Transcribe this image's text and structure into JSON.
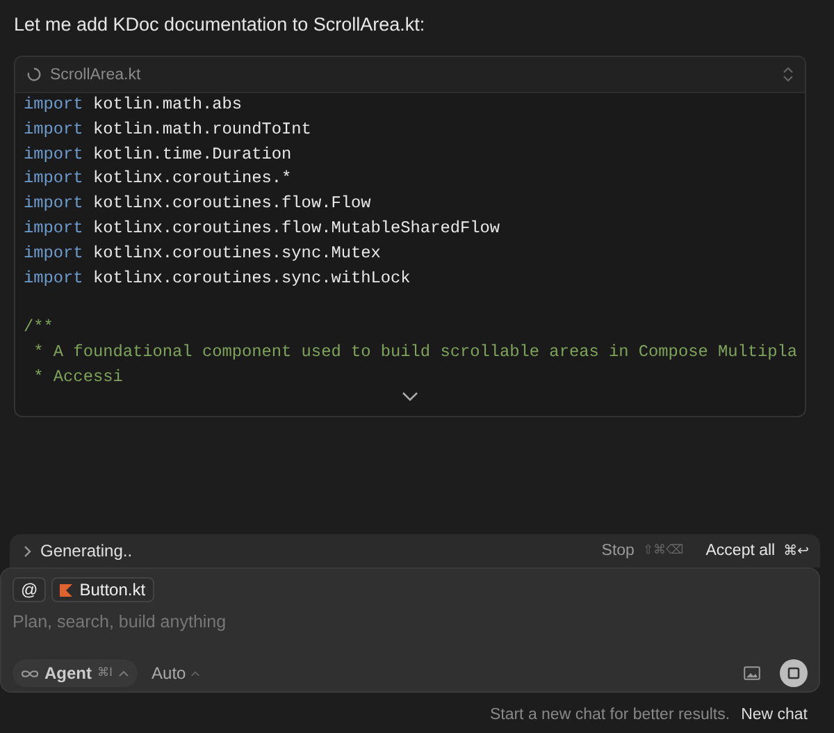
{
  "message": "Let me add KDoc documentation to ScrollArea.kt:",
  "code_card": {
    "file_name": "ScrollArea.kt",
    "lines": [
      {
        "kind": "import",
        "keyword": "import",
        "text": "kotlin.math.abs"
      },
      {
        "kind": "import",
        "keyword": "import",
        "text": "kotlin.math.roundToInt"
      },
      {
        "kind": "import",
        "keyword": "import",
        "text": "kotlin.time.Duration"
      },
      {
        "kind": "import",
        "keyword": "import",
        "text": "kotlinx.coroutines.*"
      },
      {
        "kind": "import",
        "keyword": "import",
        "text": "kotlinx.coroutines.flow.Flow"
      },
      {
        "kind": "import",
        "keyword": "import",
        "text": "kotlinx.coroutines.flow.MutableSharedFlow"
      },
      {
        "kind": "import",
        "keyword": "import",
        "text": "kotlinx.coroutines.sync.Mutex"
      },
      {
        "kind": "import",
        "keyword": "import",
        "text": "kotlinx.coroutines.sync.withLock"
      },
      {
        "kind": "blank"
      },
      {
        "kind": "comment",
        "text": "/**"
      },
      {
        "kind": "comment",
        "text": " * A foundational component used to build scrollable areas in Compose Multipla"
      },
      {
        "kind": "comment",
        "text": " * Accessi"
      }
    ]
  },
  "status_bar": {
    "label": "Generating..",
    "stop": "Stop",
    "stop_shortcut": "⇧⌘⌫",
    "accept": "Accept all",
    "accept_shortcut": "⌘↩"
  },
  "composer": {
    "mention": "@",
    "context_file": "Button.kt",
    "placeholder": "Plan, search, build anything",
    "mode": "Agent",
    "mode_shortcut": "⌘I",
    "model": "Auto"
  },
  "footer": {
    "hint": "Start a new chat for better results.",
    "new_chat": "New chat"
  }
}
